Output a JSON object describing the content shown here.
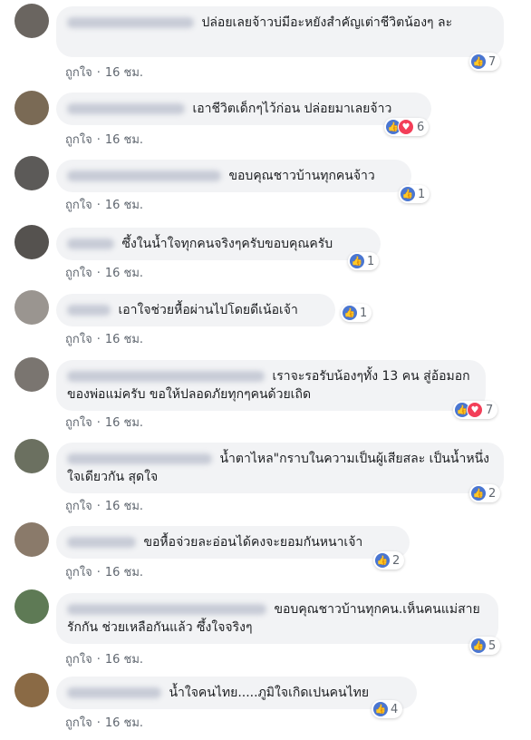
{
  "comments": [
    {
      "text": "ปล่อยเลยจ้าวบ่มีอะหยังสำคัญเต่าชีวิตน้องๆ ละ",
      "like_label": "ถูกใจ",
      "time": "16 ชม.",
      "reactions": {
        "types": [
          "like"
        ],
        "count": "7"
      },
      "avatar_color": "#6a6560"
    },
    {
      "text": "เอาชีวิตเด็กๆไว้ก่อน ปล่อยมาเลยจ้าว",
      "like_label": "ถูกใจ",
      "time": "16 ชม.",
      "reactions": {
        "types": [
          "like",
          "love"
        ],
        "count": "6"
      },
      "avatar_color": "#7a6a55"
    },
    {
      "text": "ขอบคุณชาวบ้านทุกคนจ้าว",
      "like_label": "ถูกใจ",
      "time": "16 ชม.",
      "reactions": {
        "types": [
          "like"
        ],
        "count": "1"
      },
      "avatar_color": "#5c5a58"
    },
    {
      "text": "ซึ้งในน้ำใจทุกคนจริงๆครับขอบคุณครับ",
      "like_label": "ถูกใจ",
      "time": "16 ชม.",
      "reactions": {
        "types": [
          "like"
        ],
        "count": "1"
      },
      "avatar_color": "#55524f"
    },
    {
      "text": "เอาใจช่วยหื้อผ่านไปโดยดีเน้อเจ้า",
      "like_label": "ถูกใจ",
      "time": "16 ชม.",
      "reactions": {
        "types": [
          "like"
        ],
        "count": "1"
      },
      "avatar_color": "#9a9590"
    },
    {
      "text": "เราจะรอรับน้องๆทั้ง 13 คน สู่อ้อมอกของพ่อแม่ครับ ขอให้ปลอดภัยทุกๆคนด้วยเถิด",
      "like_label": "ถูกใจ",
      "time": "16 ชม.",
      "reactions": {
        "types": [
          "like",
          "love"
        ],
        "count": "7"
      },
      "avatar_color": "#7a7570"
    },
    {
      "text": "น้ำตาไหล\"กราบในความเป็นผู้เสียสละ เป็นน้ำหนึ่งใจเดียวกัน สุดใจ",
      "like_label": "ถูกใจ",
      "time": "16 ชม.",
      "reactions": {
        "types": [
          "like"
        ],
        "count": "2"
      },
      "avatar_color": "#6b7060"
    },
    {
      "text": "ขอหื้อจ่วยละอ่อนได้คงจะยอมกันหนาเจ้า",
      "like_label": "ถูกใจ",
      "time": "16 ชม.",
      "reactions": {
        "types": [
          "like"
        ],
        "count": "2"
      },
      "avatar_color": "#8a7a6a"
    },
    {
      "text": "ขอบคุณชาวบ้านทุกคน.เห็นคนแม่สายรักกัน ช่วยเหลือกันแล้ว ซึ้งใจจริงๆ",
      "like_label": "ถูกใจ",
      "time": "16 ชม.",
      "reactions": {
        "types": [
          "like"
        ],
        "count": "5"
      },
      "avatar_color": "#5e7a55"
    },
    {
      "text": "น้ำใจคนไทย.....ภูมิใจเกิดเปนคนไทย",
      "like_label": "ถูกใจ",
      "time": "16 ชม.",
      "reactions": {
        "types": [
          "like"
        ],
        "count": "4"
      },
      "avatar_color": "#8a6a45"
    }
  ]
}
